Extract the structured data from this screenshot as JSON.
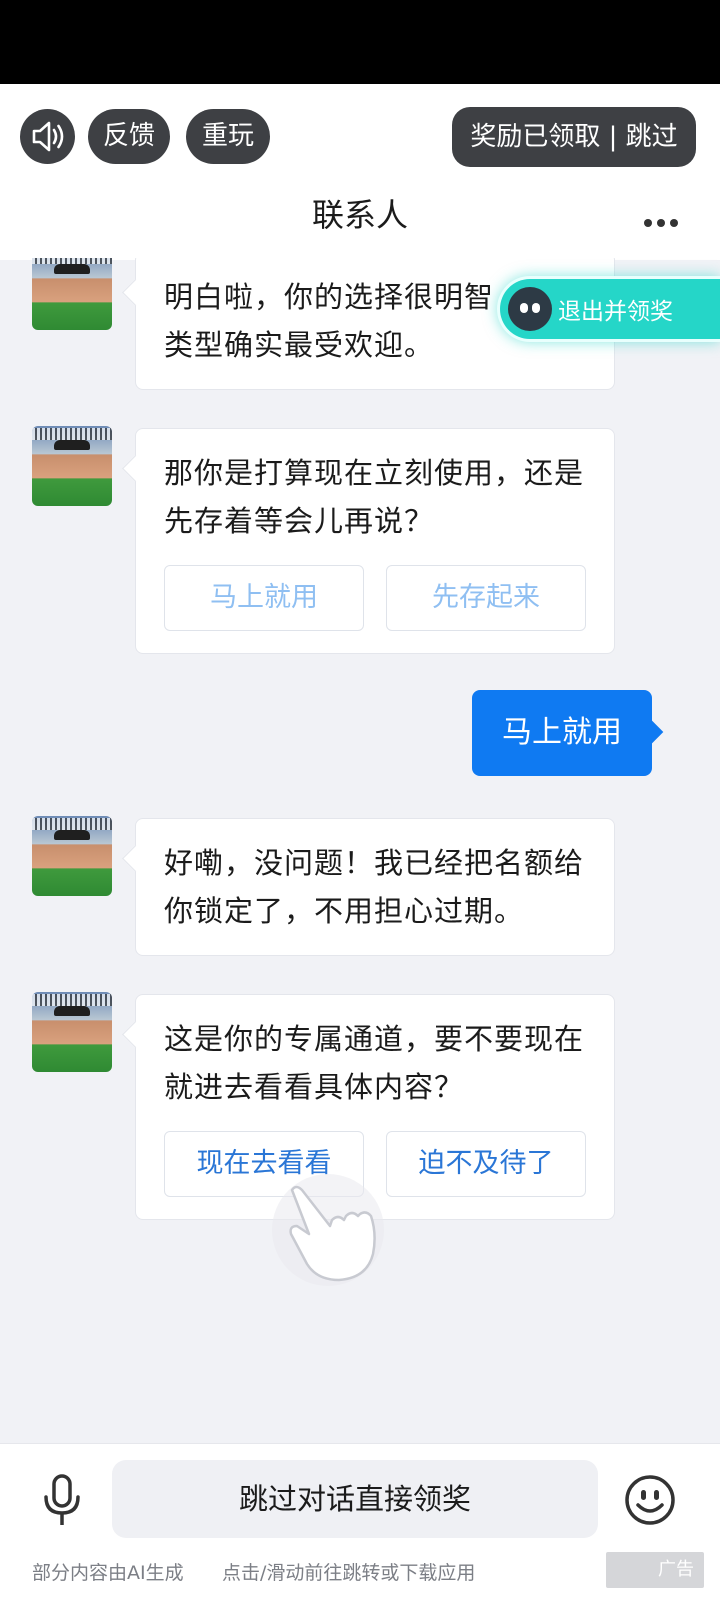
{
  "topbar": {
    "feedback_label": "反馈",
    "replay_label": "重玩",
    "reward_label": "奖励已领取 | 跳过",
    "title": "联系人"
  },
  "floating": {
    "exit_label": "退出并领奖"
  },
  "messages": [
    {
      "text": "明白啦，你的选择很明智，这个类型确实最受欢迎。"
    },
    {
      "text": "那你是打算现在立刻使用，还是先存着等会儿再说？",
      "options": [
        "马上就用",
        "先存起来"
      ]
    },
    {
      "user_text": "马上就用"
    },
    {
      "text": "好嘞，没问题！我已经把名额给你锁定了，不用担心过期。"
    },
    {
      "text": "这是你的专属通道，要不要现在就进去看看具体内容？",
      "options": [
        "现在去看看",
        "迫不及待了"
      ]
    }
  ],
  "bottom": {
    "input_label": "跳过对话直接领奖",
    "footer_left": "部分内容由AI生成",
    "footer_mid": "点击/滑动前往跳转或下载应用",
    "ad_label": "广告"
  },
  "icons": [
    "speaker-icon",
    "more-icon",
    "exit-ghost-icon",
    "hand-pointer-icon",
    "microphone-icon",
    "smiley-icon"
  ],
  "colors": {
    "primary_blue": "#0f7af2",
    "teal": "#25d6c8",
    "dark_pill": "#3e4044"
  }
}
